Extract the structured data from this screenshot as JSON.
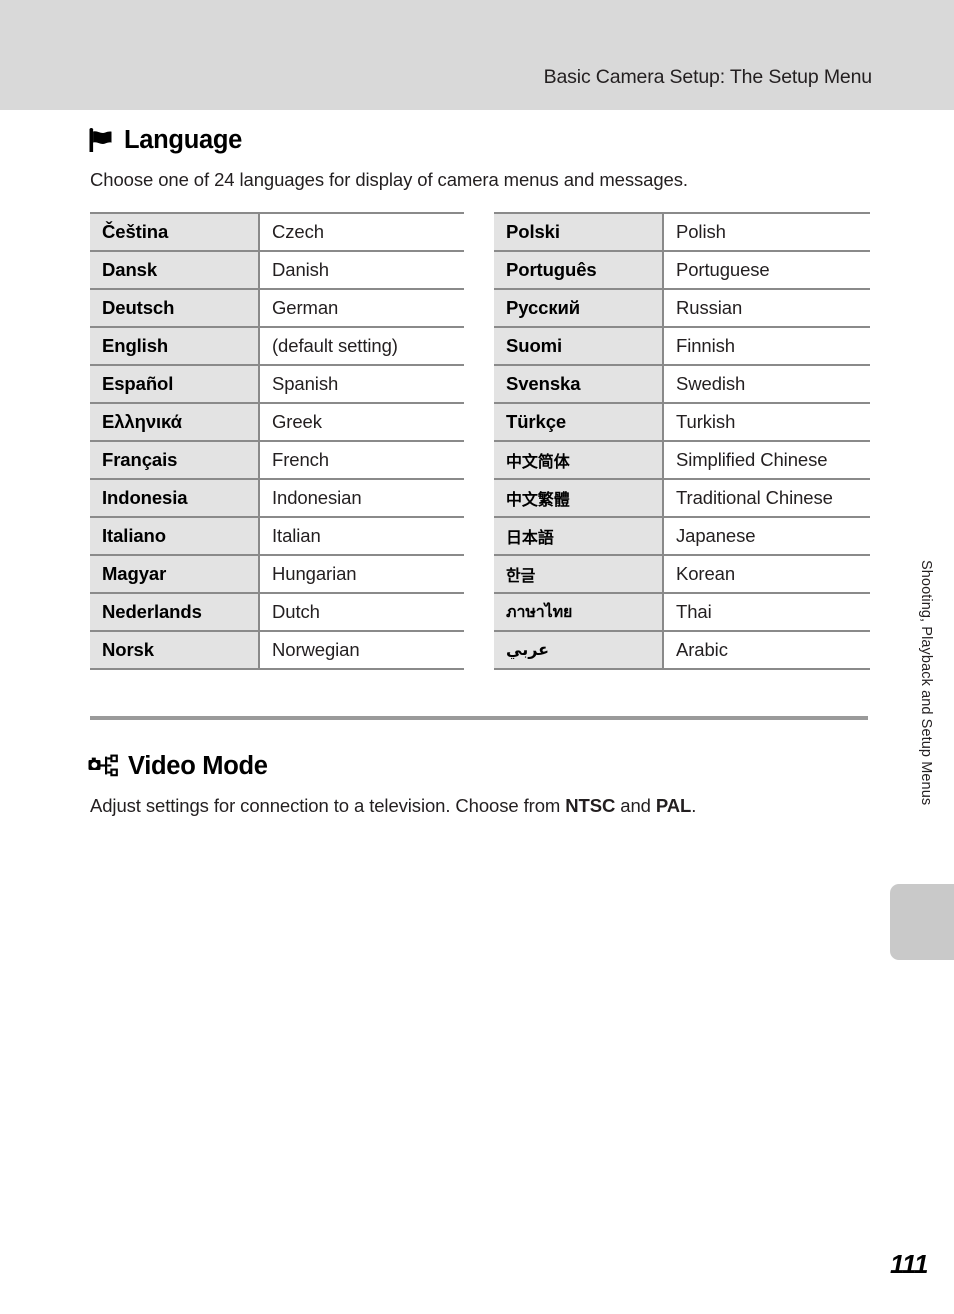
{
  "header": {
    "title": "Basic Camera Setup: The Setup Menu"
  },
  "sections": {
    "language": {
      "icon": "flag-icon",
      "title": "Language",
      "description": "Choose one of 24 languages for display of camera menus and messages."
    },
    "video_mode": {
      "icon": "video-out-icon",
      "title": "Video Mode",
      "description_before": "Adjust settings for connection to a television. Choose from ",
      "option_1": "NTSC",
      "description_middle": " and ",
      "option_2": "PAL",
      "description_after": "."
    }
  },
  "language_table": {
    "left": [
      {
        "native": "Čeština",
        "english": "Czech"
      },
      {
        "native": "Dansk",
        "english": "Danish"
      },
      {
        "native": "Deutsch",
        "english": "German"
      },
      {
        "native": "English",
        "english": "(default setting)"
      },
      {
        "native": "Español",
        "english": "Spanish"
      },
      {
        "native": "Ελληνικά",
        "english": "Greek"
      },
      {
        "native": "Français",
        "english": "French"
      },
      {
        "native": "Indonesia",
        "english": "Indonesian"
      },
      {
        "native": "Italiano",
        "english": "Italian"
      },
      {
        "native": "Magyar",
        "english": "Hungarian"
      },
      {
        "native": "Nederlands",
        "english": "Dutch"
      },
      {
        "native": "Norsk",
        "english": "Norwegian"
      }
    ],
    "right": [
      {
        "native": "Polski",
        "english": "Polish"
      },
      {
        "native": "Português",
        "english": "Portuguese"
      },
      {
        "native": "Русский",
        "english": "Russian"
      },
      {
        "native": "Suomi",
        "english": "Finnish"
      },
      {
        "native": "Svenska",
        "english": "Swedish"
      },
      {
        "native": "Türkçe",
        "english": "Turkish"
      },
      {
        "native": "中文简体",
        "english": "Simplified Chinese"
      },
      {
        "native": "中文繁體",
        "english": "Traditional Chinese"
      },
      {
        "native": "日本語",
        "english": "Japanese"
      },
      {
        "native": "한글",
        "english": "Korean"
      },
      {
        "native": "ภาษาไทย",
        "english": "Thai"
      },
      {
        "native": "عربي",
        "english": "Arabic"
      }
    ]
  },
  "side_tab": {
    "label": "Shooting, Playback and Setup Menus"
  },
  "footer": {
    "page_number": "111"
  },
  "colors": {
    "header_band": "#d9d9d9",
    "cell_gray": "#e3e3e3",
    "rule_gray": "#8a8a8a",
    "tab_gray": "#c9c9c9",
    "text": "#231f20"
  }
}
